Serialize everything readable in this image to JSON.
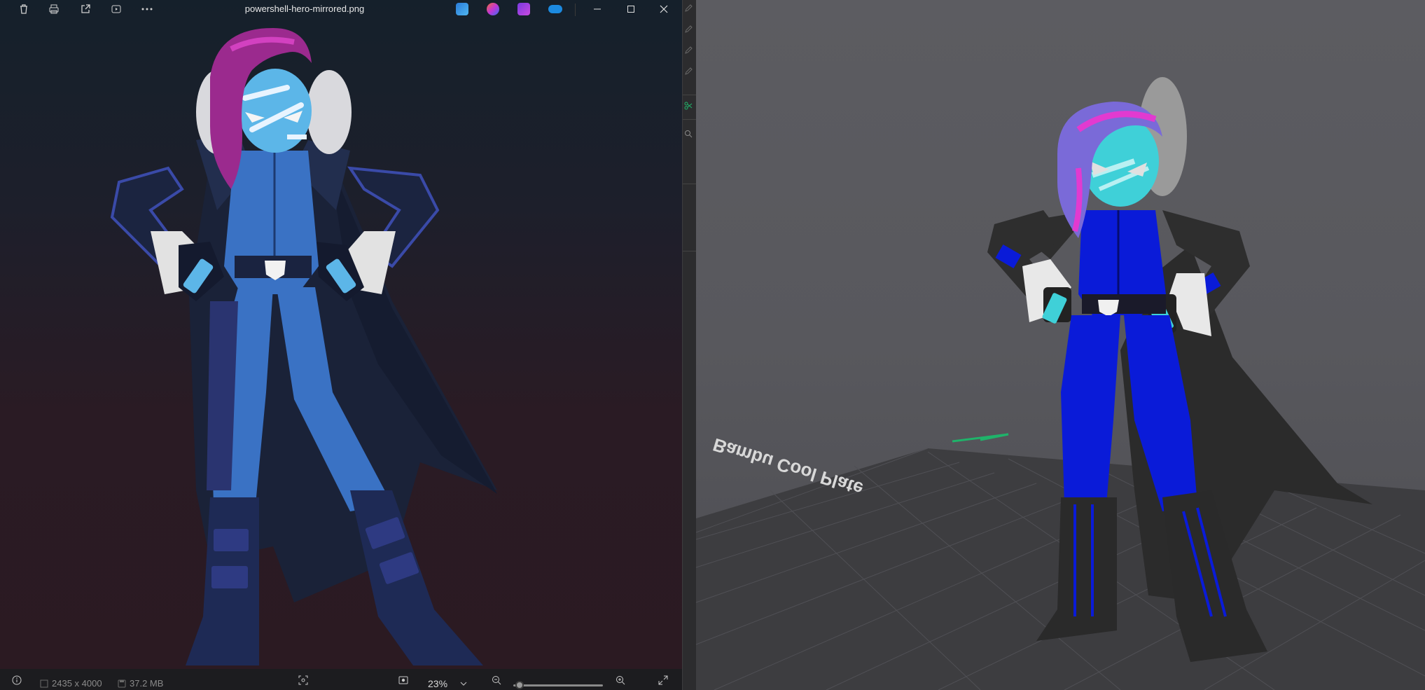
{
  "photos": {
    "filename": "powershell-hero-mirrored.png",
    "toolbar": {
      "delete_icon": "trash-icon",
      "print_icon": "printer-icon",
      "share_icon": "share-icon",
      "slideshow_icon": "play-icon",
      "more_icon": "more-icon"
    },
    "apps": [
      "edit-app-icon",
      "copilot-app-icon",
      "clipchamp-app-icon",
      "onedrive-app-icon"
    ],
    "window_controls": [
      "minimize-icon",
      "maximize-icon",
      "close-icon"
    ],
    "status": {
      "dimensions": "2435 x 4000",
      "file_size": "37.2 MB",
      "zoom": "23%",
      "zoom_level": 0.04
    }
  },
  "slicer": {
    "bed_label": "Bambu Cool Plate"
  },
  "colors": {
    "hero_skin": "#5cb6e8",
    "hero_hair": "#9b2a8e",
    "hero_suit": "#3a72c4",
    "model_blue": "#0a1bd8",
    "model_cyan": "#3fd0d8",
    "model_dark": "#2e2e2e",
    "bed": "#3d3d40"
  }
}
